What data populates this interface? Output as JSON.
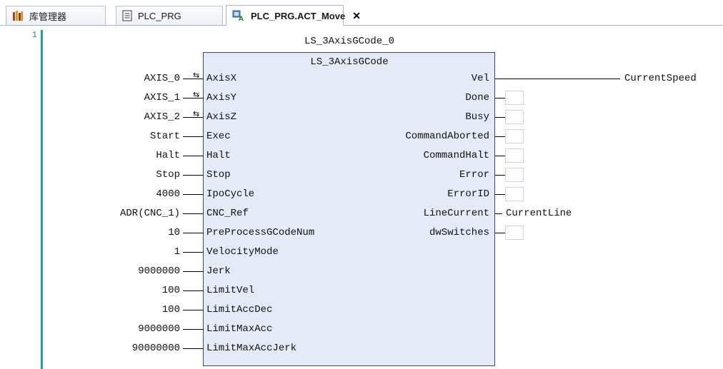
{
  "tabs": [
    {
      "label": "库管理器",
      "icon": "library-icon",
      "active": false
    },
    {
      "label": "PLC_PRG",
      "icon": "document-icon",
      "active": false
    },
    {
      "label": "PLC_PRG.ACT_Move",
      "icon": "action-icon",
      "active": true,
      "close": "✕"
    }
  ],
  "editor": {
    "line_number": "1",
    "instance_name": "LS_3AxisGCode_0",
    "block_type": "LS_3AxisGCode",
    "inputs": [
      {
        "pin": "AxisX",
        "value": "AXIS_0",
        "inout": true
      },
      {
        "pin": "AxisY",
        "value": "AXIS_1",
        "inout": true
      },
      {
        "pin": "AxisZ",
        "value": "AXIS_2",
        "inout": true
      },
      {
        "pin": "Exec",
        "value": "Start"
      },
      {
        "pin": "Halt",
        "value": "Halt"
      },
      {
        "pin": "Stop",
        "value": "Stop"
      },
      {
        "pin": "IpoCycle",
        "value": "4000"
      },
      {
        "pin": "CNC_Ref",
        "value": "ADR(CNC_1)"
      },
      {
        "pin": "PreProcessGCodeNum",
        "value": "10"
      },
      {
        "pin": "VelocityMode",
        "value": "1"
      },
      {
        "pin": "Jerk",
        "value": "9000000"
      },
      {
        "pin": "LimitVel",
        "value": "100"
      },
      {
        "pin": "LimitAccDec",
        "value": "100"
      },
      {
        "pin": "LimitMaxAcc",
        "value": "9000000"
      },
      {
        "pin": "LimitMaxAccJerk",
        "value": "90000000"
      }
    ],
    "outputs": [
      {
        "pin": "Vel",
        "target": "CurrentSpeed"
      },
      {
        "pin": "Done",
        "target": ""
      },
      {
        "pin": "Busy",
        "target": ""
      },
      {
        "pin": "CommandAborted",
        "target": ""
      },
      {
        "pin": "CommandHalt",
        "target": ""
      },
      {
        "pin": "Error",
        "target": ""
      },
      {
        "pin": "ErrorID",
        "target": ""
      },
      {
        "pin": "LineCurrent",
        "target": "CurrentLine"
      },
      {
        "pin": "dwSwitches",
        "target": ""
      }
    ]
  },
  "colors": {
    "block_fill": "#e3ebf6",
    "gutter_accent": "#2aa198"
  }
}
